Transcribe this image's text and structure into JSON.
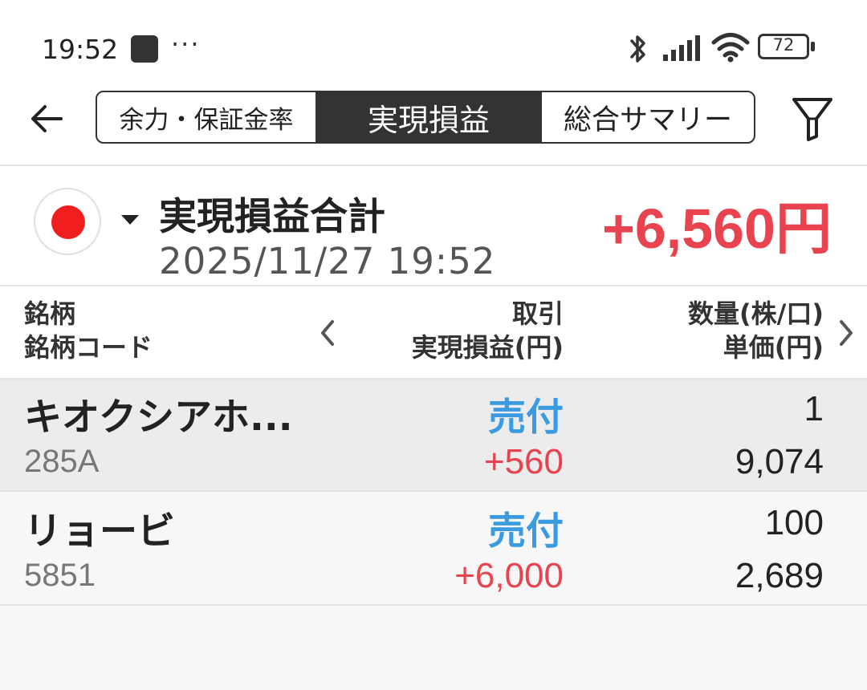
{
  "status_bar": {
    "time": "19:52",
    "dots": "···",
    "battery": "72"
  },
  "header": {
    "tabs": [
      {
        "label": "余力・保証金率",
        "selected": false
      },
      {
        "label": "実現損益",
        "selected": true
      },
      {
        "label": "総合サマリー",
        "selected": false
      }
    ]
  },
  "summary": {
    "title": "実現損益合計",
    "datetime": "2025/11/27 19:52",
    "total": "+6,560円"
  },
  "columns": {
    "left": [
      "銘柄",
      "銘柄コード"
    ],
    "middle": [
      "取引",
      "実現損益(円)"
    ],
    "right": [
      "数量(株/口)",
      "単価(円)"
    ]
  },
  "rows": [
    {
      "name": "キオクシアホ...",
      "code": "285A",
      "type": "売付",
      "pnl": "+560",
      "qty": "1",
      "price": "9,074"
    },
    {
      "name": "リョービ",
      "code": "5851",
      "type": "売付",
      "pnl": "+6,000",
      "qty": "100",
      "price": "2,689"
    }
  ],
  "colors": {
    "positive": "#e8434f",
    "trade_type": "#3a9be0",
    "selected_tab": "#333333"
  }
}
